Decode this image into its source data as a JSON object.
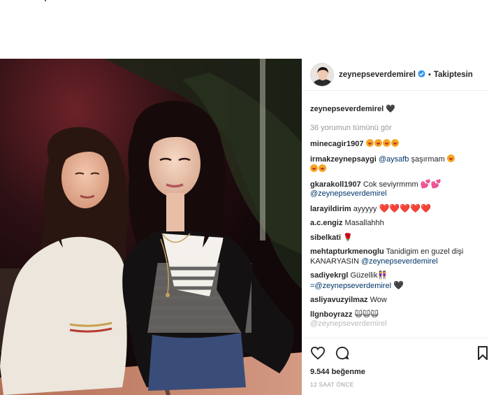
{
  "post": {
    "author": "zeynepseverdemirel",
    "follow_status": "Takiptesin",
    "separator": "•",
    "caption_user": "zeynepseverdemirel",
    "caption_text": "🖤",
    "view_all_comments": "36 yorumun tümünü gör",
    "likes": "9.544 beğenme",
    "time_ago": "12 SAAT ÖNCE"
  },
  "comments": [
    {
      "user": "minecagir1907",
      "text": "",
      "emoji_count": 4
    },
    {
      "user": "irmakzeynepsaygi",
      "mention": "@aysafb",
      "text": " şaşırmam",
      "emoji_count": 1,
      "emoji2_count": 2
    },
    {
      "user": "gkarakoll1907",
      "text": "Cok seviyrmmm",
      "mention": "@zeynepseverdemirel"
    },
    {
      "user": "larayildirim",
      "text": "ayyyyy",
      "hearts": "❤️❤️❤️❤️❤️"
    },
    {
      "user": "a.c.engiz",
      "text": "Masallahhh"
    },
    {
      "user": "sibelkati",
      "text": "🌹"
    },
    {
      "user": "mehtapturkmenoglu",
      "text": "Tanidigim en guzel dişi KANARYASIN",
      "mention": "@zeynepseverdemirel"
    },
    {
      "user": "sadiyekrgl",
      "text": "Güzellik👭",
      "mention": "=@zeynepseverdemirel",
      "tail": "🖤"
    },
    {
      "user": "asliyavuzyilmaz",
      "text": "Wow"
    },
    {
      "user": "llgnboyrazz",
      "text": "🙀🙀🙀",
      "mention": "@zeynepseverdemirel"
    }
  ],
  "icons": {
    "verified": "verified-badge-icon",
    "like": "heart-outline-icon",
    "comment": "comment-bubble-icon",
    "save": "bookmark-icon"
  },
  "colors": {
    "mention": "#003569",
    "verified": "#3897f0",
    "muted": "#999999"
  }
}
